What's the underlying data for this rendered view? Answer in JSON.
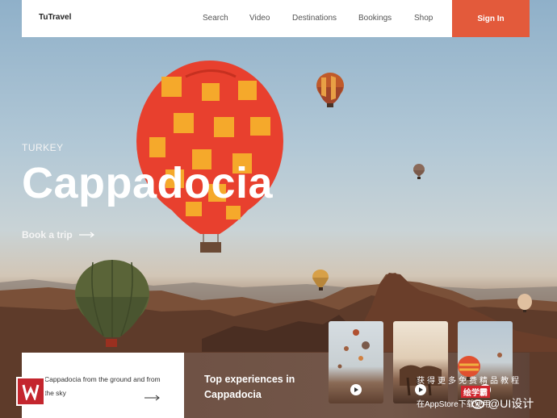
{
  "brand": "TuTravel",
  "nav": {
    "links": [
      "Search",
      "Video",
      "Destinations",
      "Bookings",
      "Shop"
    ],
    "signin": "Sign In"
  },
  "hero": {
    "country": "TURKEY",
    "title": "Cappadocia",
    "cta": "Book a trip"
  },
  "bottom": {
    "description": "Cappadocia from the ground and from the sky",
    "experiences": "Top experiences in Cappadocia"
  },
  "watermark": {
    "line1": "获得更多免费精品教程",
    "line2": "绘学霸",
    "line3": "在AppStore下载使用",
    "line4": "@UI设计"
  },
  "colors": {
    "accent": "#e35a3b",
    "card_brown": "#735749"
  },
  "icons": [
    "arrow-right-icon",
    "play-icon",
    "logo-icon",
    "weibo-icon"
  ]
}
